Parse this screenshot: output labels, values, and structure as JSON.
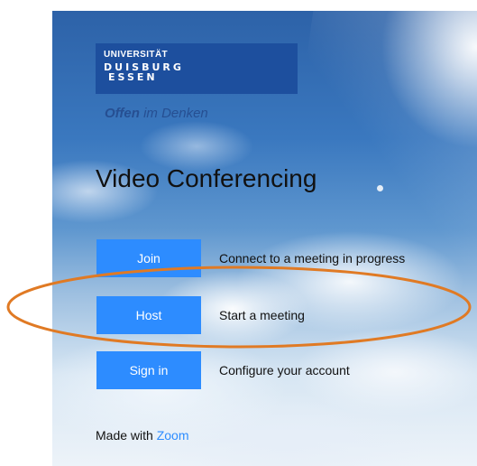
{
  "logo": {
    "line1": "UNIVERSITÄT",
    "line2": "DUISBURG",
    "line3": "ESSEN",
    "tagline_bold": "Offen",
    "tagline_rest": " im Denken",
    "color": "#1d4f9e"
  },
  "page": {
    "title": "Video Conferencing"
  },
  "actions": [
    {
      "button": "Join",
      "description": "Connect to a meeting in progress"
    },
    {
      "button": "Host",
      "description": "Start a meeting"
    },
    {
      "button": "Sign in",
      "description": "Configure your account"
    }
  ],
  "footer": {
    "prefix": "Made with ",
    "link": "Zoom"
  },
  "colors": {
    "button": "#2d8cff",
    "highlight_ellipse": "#e07a24"
  }
}
